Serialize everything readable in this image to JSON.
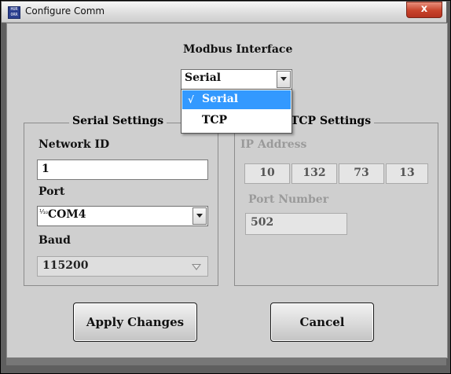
{
  "window": {
    "title": "Configure Comm",
    "app_icon_text": "HUR ORR",
    "close_label": "x"
  },
  "modbus": {
    "heading": "Modbus Interface",
    "selected": "Serial",
    "options": [
      {
        "label": "Serial",
        "checked": true,
        "check_mark": "√"
      },
      {
        "label": "TCP",
        "checked": false
      }
    ]
  },
  "serial": {
    "group_title": "Serial Settings",
    "network_id_label": "Network ID",
    "network_id_value": "1",
    "port_label": "Port",
    "port_value": "COM4",
    "port_icon": "⅒",
    "baud_label": "Baud",
    "baud_value": "115200"
  },
  "tcp": {
    "group_title": "TCP Settings",
    "ip_label": "IP Address",
    "ip_octets": [
      "10",
      "132",
      "73",
      "13"
    ],
    "port_number_label": "Port Number",
    "port_number_value": "502"
  },
  "buttons": {
    "apply": "Apply Changes",
    "cancel": "Cancel"
  },
  "colors": {
    "selection": "#3399ff",
    "close_button": "#c8432b",
    "dialog_bg": "#cfcfcf"
  }
}
